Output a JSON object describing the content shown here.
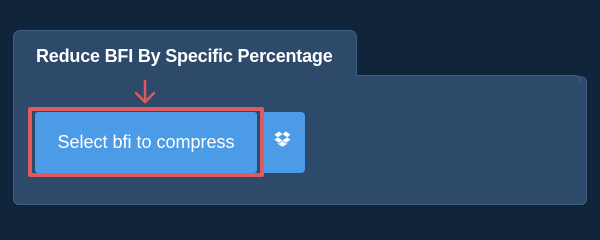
{
  "tab": {
    "title": "Reduce BFI By Specific Percentage"
  },
  "upload": {
    "select_label": "Select bfi to compress",
    "dropbox_icon": "dropbox-icon"
  },
  "annotation": {
    "highlight_color": "#e0595f",
    "arrow_icon": "down-arrow-icon"
  },
  "colors": {
    "page_background": "#10243a",
    "panel_background": "#2d4a6b",
    "button_background": "#4c9be6"
  }
}
